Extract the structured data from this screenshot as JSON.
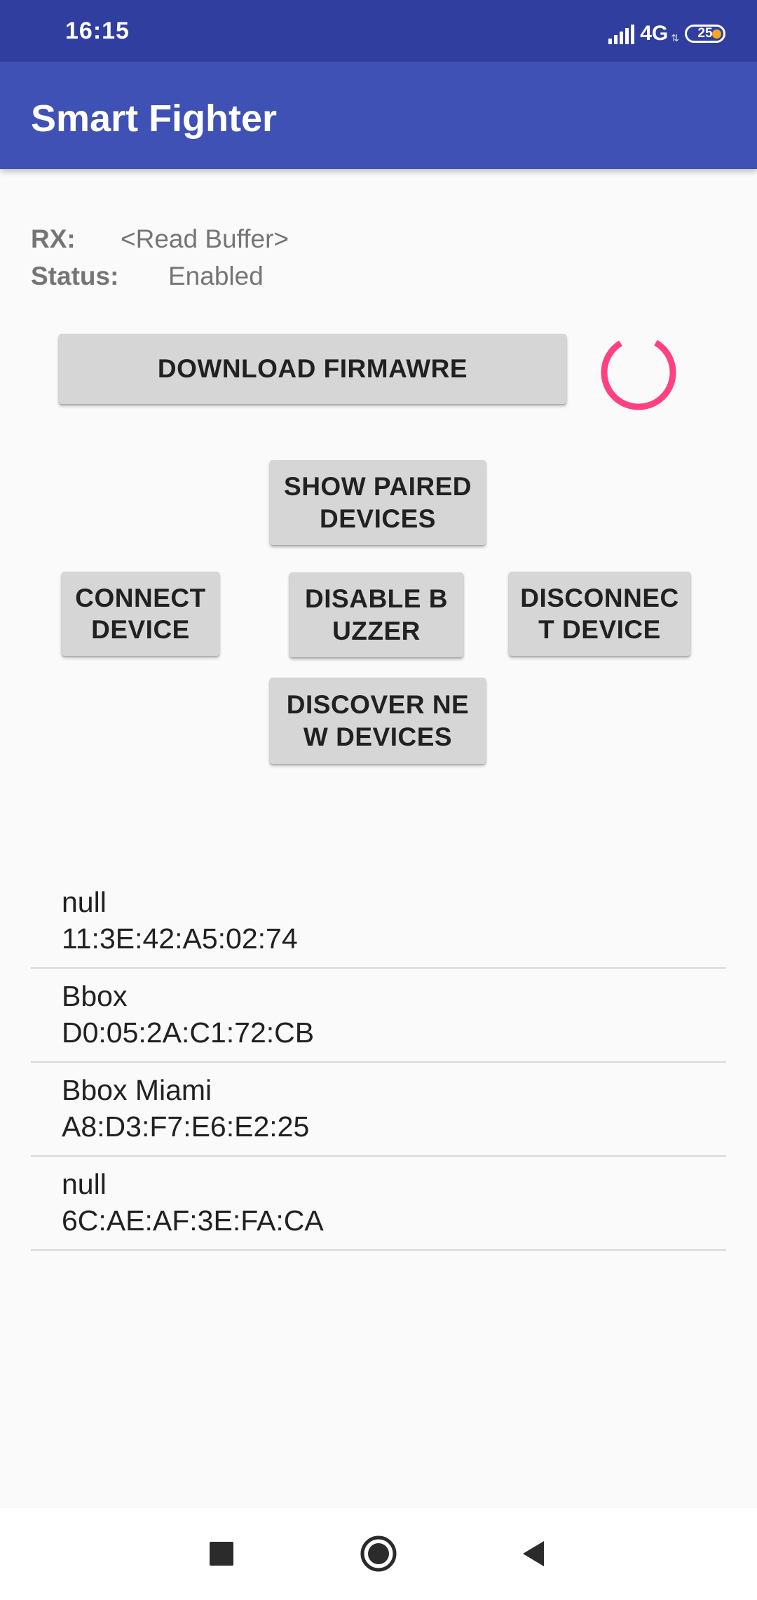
{
  "status_bar": {
    "time": "16:15",
    "network": "4G",
    "battery": "25",
    "icons": {
      "signal": "signal-icon",
      "battery": "battery-icon"
    }
  },
  "app_bar": {
    "title": "Smart Fighter"
  },
  "info": {
    "rx_label": "RX:",
    "rx_value": "<Read Buffer>",
    "status_label": "Status:",
    "status_value": "Enabled"
  },
  "buttons": {
    "download_firmware": "DOWNLOAD FIRMAWRE",
    "show_paired": "SHOW PAIRED DEVICES",
    "connect": "CONNECT DEVICE",
    "disable_buzzer": "DISABLE BUZZER",
    "disconnect": "DISCONNEC T DEVICE",
    "discover": "DISCOVER NEW DEVICES"
  },
  "progress_indicator": {
    "icon": "spinner-icon",
    "color": "#ff4081"
  },
  "devices": [
    {
      "name": "null",
      "address": "11:3E:42:A5:02:74"
    },
    {
      "name": "Bbox",
      "address": "D0:05:2A:C1:72:CB"
    },
    {
      "name": "Bbox Miami",
      "address": "A8:D3:F7:E6:E2:25"
    },
    {
      "name": "null",
      "address": "6C:AE:AF:3E:FA:CA"
    }
  ],
  "nav_bar": {
    "recents": "recents-square-icon",
    "home": "home-circle-icon",
    "back": "back-triangle-icon"
  },
  "colors": {
    "primary": "#3f51b5",
    "primary_dark": "#303f9f",
    "accent": "#ff4081",
    "button_bg": "#d6d6d6"
  }
}
